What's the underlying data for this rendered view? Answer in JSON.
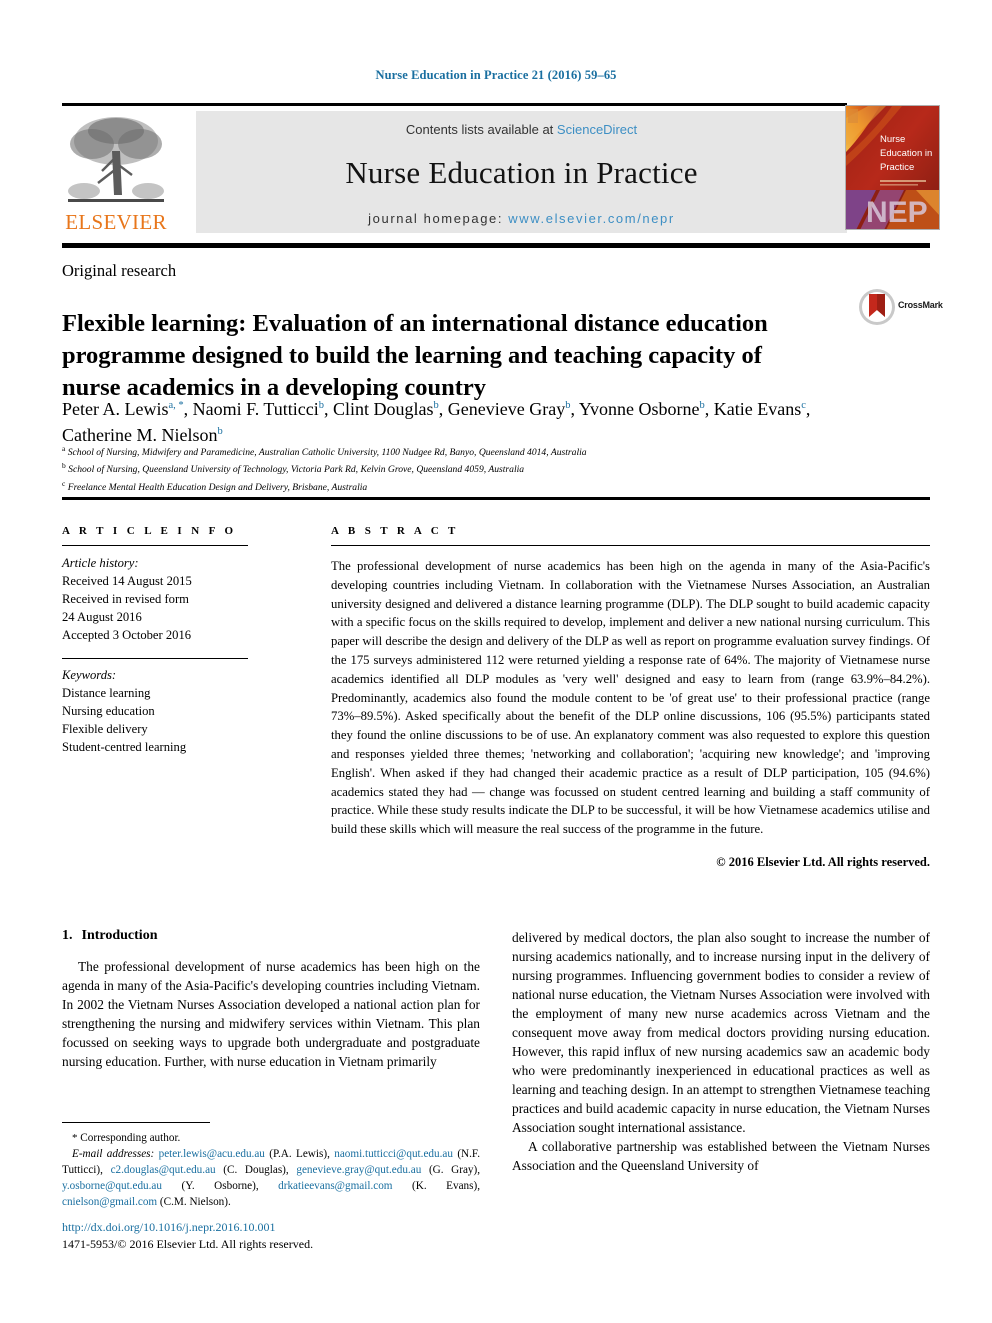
{
  "running_head": "Nurse Education in Practice 21 (2016) 59–65",
  "masthead": {
    "contents_prefix": "Contents lists available at",
    "sciencedirect": "ScienceDirect",
    "journal_title": "Nurse Education in Practice",
    "homepage_prefix": "journal homepage:",
    "homepage_url": "www.elsevier.com/nepr",
    "publisher_wordmark": "ELSEVIER",
    "publisher_logo_icon": "elsevier-tree-icon"
  },
  "cover": {
    "line1": "Nurse",
    "line2": "Education in",
    "line3": "Practice",
    "wordmark": "NEP",
    "colors": {
      "dark_red": "#8d1f12",
      "red": "#b7291a",
      "orange": "#e8761b",
      "gold": "#f0a93c",
      "purple": "#7b4a9e"
    }
  },
  "crossmark": {
    "label": "CrossMark",
    "icon": "crossmark-icon"
  },
  "article": {
    "type": "Original research",
    "title": "Flexible learning: Evaluation of an international distance education programme designed to build the learning and teaching capacity of nurse academics in a developing country",
    "authors_line1": "Peter A. Lewis",
    "authors": [
      {
        "name": "Peter A. Lewis",
        "marks": "a, *"
      },
      {
        "name": "Naomi F. Tutticci",
        "marks": "b"
      },
      {
        "name": "Clint Douglas",
        "marks": "b"
      },
      {
        "name": "Genevieve Gray",
        "marks": "b"
      },
      {
        "name": "Yvonne Osborne",
        "marks": "b"
      },
      {
        "name": "Katie Evans",
        "marks": "c"
      },
      {
        "name": "Catherine M. Nielson",
        "marks": "b"
      }
    ],
    "affiliations": [
      {
        "label": "a",
        "text": "School of Nursing, Midwifery and Paramedicine, Australian Catholic University, 1100 Nudgee Rd, Banyo, Queensland 4014, Australia"
      },
      {
        "label": "b",
        "text": "School of Nursing, Queensland University of Technology, Victoria Park Rd, Kelvin Grove, Queensland 4059, Australia"
      },
      {
        "label": "c",
        "text": "Freelance Mental Health Education Design and Delivery, Brisbane, Australia"
      }
    ]
  },
  "article_info": {
    "heading": "A R T I C L E  I N F O",
    "history_label": "Article history:",
    "history": [
      "Received 14 August 2015",
      "Received in revised form",
      "24 August 2016",
      "Accepted 3 October 2016"
    ],
    "keywords_label": "Keywords:",
    "keywords": [
      "Distance learning",
      "Nursing education",
      "Flexible delivery",
      "Student-centred learning"
    ]
  },
  "abstract": {
    "heading": "A B S T R A C T",
    "text": "The professional development of nurse academics has been high on the agenda in many of the Asia-Pacific's developing countries including Vietnam. In collaboration with the Vietnamese Nurses Association, an Australian university designed and delivered a distance learning programme (DLP). The DLP sought to build academic capacity with a specific focus on the skills required to develop, implement and deliver a new national nursing curriculum. This paper will describe the design and delivery of the DLP as well as report on programme evaluation survey findings. Of the 175 surveys administered 112 were returned yielding a response rate of 64%. The majority of Vietnamese nurse academics identified all DLP modules as 'very well' designed and easy to learn from (range 63.9%–84.2%). Predominantly, academics also found the module content to be 'of great use' to their professional practice (range 73%–89.5%). Asked specifically about the benefit of the DLP online discussions, 106 (95.5%) participants stated they found the online discussions to be of use. An explanatory comment was also requested to explore this question and responses yielded three themes; 'networking and collaboration'; 'acquiring new knowledge'; and 'improving English'. When asked if they had changed their academic practice as a result of DLP participation, 105 (94.6%) academics stated they had — change was focussed on student centred learning and building a staff community of practice. While these study results indicate the DLP to be successful, it will be how Vietnamese academics utilise and build these skills which will measure the real success of the programme in the future.",
    "copyright": "© 2016 Elsevier Ltd. All rights reserved."
  },
  "body": {
    "section_number": "1.",
    "section_title": "Introduction",
    "left_para": "The professional development of nurse academics has been high on the agenda in many of the Asia-Pacific's developing countries including Vietnam. In 2002 the Vietnam Nurses Association developed a national action plan for strengthening the nursing and midwifery services within Vietnam. This plan focussed on seeking ways to upgrade both undergraduate and postgraduate nursing education. Further, with nurse education in Vietnam primarily",
    "right_para_continued": "delivered by medical doctors, the plan also sought to increase the number of nursing academics nationally, and to increase nursing input in the delivery of nursing programmes. Influencing government bodies to consider a review of national nurse education, the Vietnam Nurses Association were involved with the employment of many new nurse academics across Vietnam and the consequent move away from medical doctors providing nursing education. However, this rapid influx of new nursing academics saw an academic body who were predominantly inexperienced in educational practices as well as learning and teaching design. In an attempt to strengthen Vietnamese teaching practices and build academic capacity in nurse education, the Vietnam Nurses Association sought international assistance.",
    "right_para_2": "A collaborative partnership was established between the Vietnam Nurses Association and the Queensland University of"
  },
  "footnotes": {
    "corresponding_marker": "*",
    "corresponding_text": "Corresponding author.",
    "email_label": "E-mail addresses:",
    "emails": [
      {
        "address": "peter.lewis@acu.edu.au",
        "owner": "(P.A. Lewis)"
      },
      {
        "address": "naomi.tutticci@qut.edu.au",
        "owner": "(N.F. Tutticci)"
      },
      {
        "address": "c2.douglas@qut.edu.au",
        "owner": "(C. Douglas)"
      },
      {
        "address": "genevieve.gray@qut.edu.au",
        "owner": "(G. Gray)"
      },
      {
        "address": "y.osborne@qut.edu.au",
        "owner": "(Y. Osborne)"
      },
      {
        "address": "drkatieevans@gmail.com",
        "owner": "(K. Evans)"
      },
      {
        "address": "cnielson@gmail.com",
        "owner": "(C.M. Nielson)"
      }
    ]
  },
  "doi": {
    "url": "http://dx.doi.org/10.1016/j.nepr.2016.10.001",
    "issn_line": "1471-5953/© 2016 Elsevier Ltd. All rights reserved."
  },
  "colors": {
    "link_blue": "#1a6fa0",
    "sd_blue": "#3d8fc4",
    "elsevier_orange": "#e8761b",
    "band_gray": "#e6e6e6"
  }
}
